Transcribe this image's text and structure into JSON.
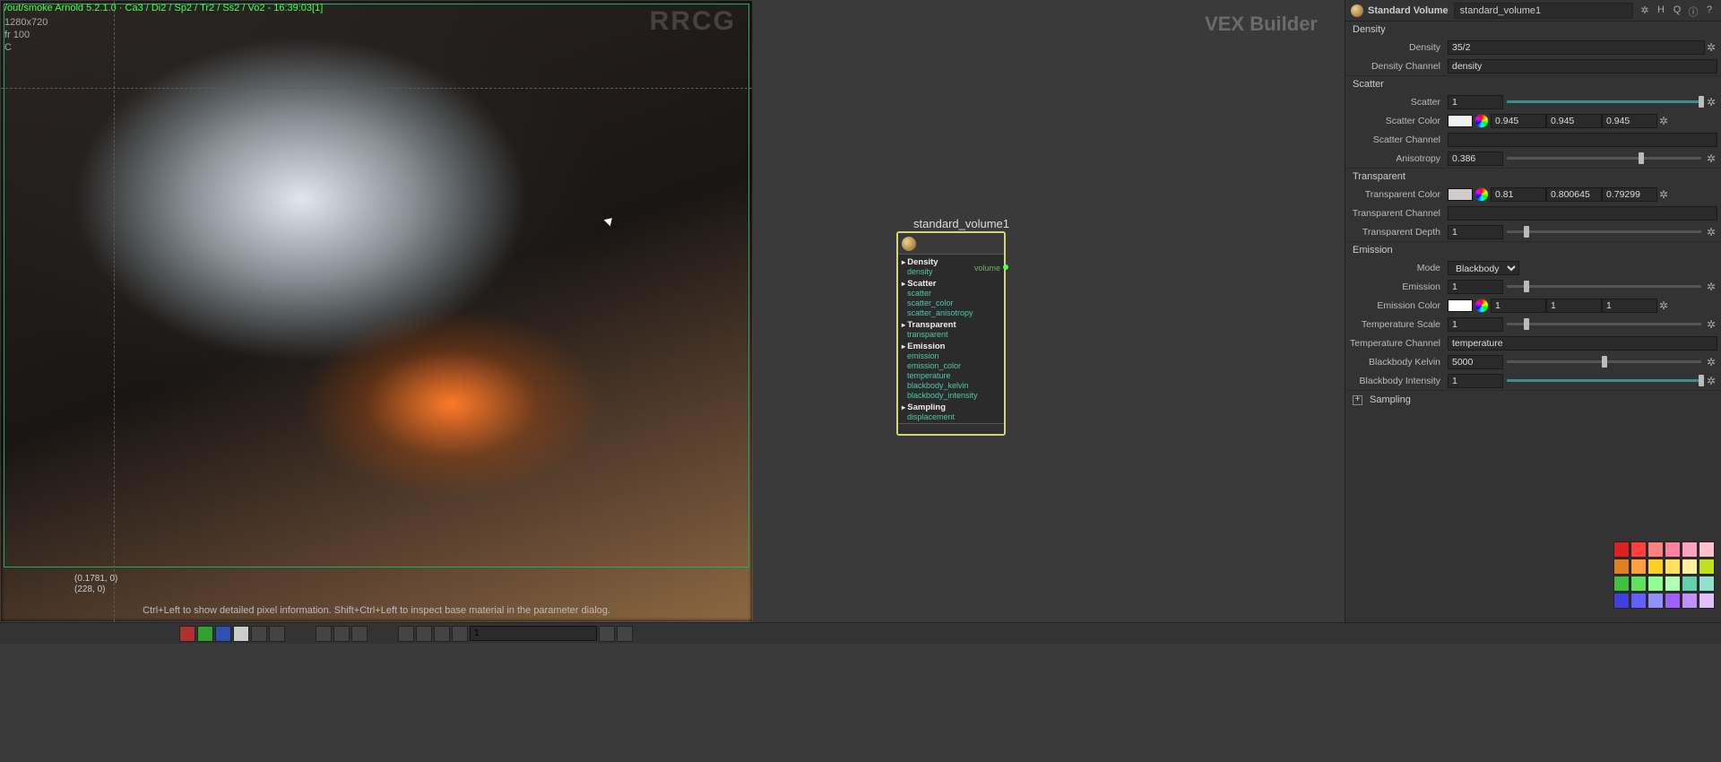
{
  "viewport": {
    "path": "/out/smoke  Arnold 5.2.1.0 · Ca3 / Di2 / Sp2 / Tr2 / Ss2 / Vo2 - 16:39:03[1]",
    "resolution": "1280x720",
    "frame": "fr 100",
    "channel": "C",
    "coord1": "(0.1781, 0)",
    "coord2": "(228, 0)",
    "hint": "Ctrl+Left to show detailed pixel information. Shift+Ctrl+Left to inspect base material in the parameter dialog.",
    "watermark": "RRCG"
  },
  "network": {
    "panel_label": "VEX Builder",
    "node_title": "standard_volume1",
    "out_port": "volume",
    "sections": [
      {
        "title": "Density",
        "items": [
          "density"
        ]
      },
      {
        "title": "Scatter",
        "items": [
          "scatter",
          "scatter_color",
          "scatter_anisotropy"
        ]
      },
      {
        "title": "Transparent",
        "items": [
          "transparent"
        ]
      },
      {
        "title": "Emission",
        "items": [
          "emission",
          "emission_color",
          "temperature",
          "blackbody_kelvin",
          "blackbody_intensity"
        ]
      },
      {
        "title": "Sampling",
        "items": [
          "displacement"
        ]
      }
    ]
  },
  "props": {
    "type": "Standard Volume",
    "name": "standard_volume1",
    "sections": {
      "density": {
        "title": "Density",
        "density": "35/2",
        "density_label": "Density",
        "channel_label": "Density Channel",
        "channel": "density"
      },
      "scatter": {
        "title": "Scatter",
        "scatter_label": "Scatter",
        "scatter": "1",
        "color_label": "Scatter Color",
        "color_r": "0.945",
        "color_g": "0.945",
        "color_b": "0.945",
        "channel_label": "Scatter Channel",
        "channel": "",
        "aniso_label": "Anisotropy",
        "aniso": "0.386"
      },
      "transparent": {
        "title": "Transparent",
        "color_label": "Transparent Color",
        "color_r": "0.81",
        "color_g": "0.800645",
        "color_b": "0.79299",
        "channel_label": "Transparent Channel",
        "channel": "",
        "depth_label": "Transparent Depth",
        "depth": "1"
      },
      "emission": {
        "title": "Emission",
        "mode_label": "Mode",
        "mode": "Blackbody",
        "emission_label": "Emission",
        "emission": "1",
        "color_label": "Emission Color",
        "color_r": "1",
        "color_g": "1",
        "color_b": "1",
        "temp_scale_label": "Temperature Scale",
        "temp_scale": "1",
        "temp_channel_label": "Temperature Channel",
        "temp_channel": "temperature",
        "kelvin_label": "Blackbody Kelvin",
        "kelvin": "5000",
        "intensity_label": "Blackbody Intensity",
        "intensity": "1"
      },
      "sampling": {
        "title": "Sampling"
      }
    }
  },
  "bottombar": {
    "field1": "1"
  }
}
